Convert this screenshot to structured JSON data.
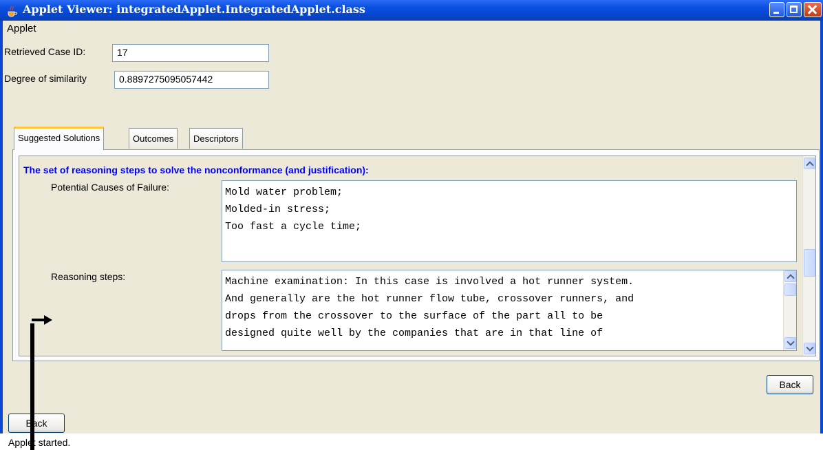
{
  "window": {
    "title": "Applet Viewer: integratedApplet.IntegratedApplet.class",
    "frame_color": "#0a47d4"
  },
  "menu": {
    "applet_label": "Applet"
  },
  "form": {
    "case_id_label": "Retrieved Case ID:",
    "case_id_value": "17",
    "similarity_label": "Degree of similarity",
    "similarity_value": "0.8897275095057442"
  },
  "tabs": [
    {
      "label": "Suggested Solutions",
      "active": true
    },
    {
      "label": "Outcomes",
      "active": false
    },
    {
      "label": "Descriptors",
      "active": false
    }
  ],
  "solutions": {
    "heading": "The set of reasoning steps to solve the nonconformance (and justification):",
    "heading_color": "#0000ff",
    "causes_label": "Potential Causes of Failure:",
    "causes_lines": [
      "Mold water problem;",
      "Molded-in stress;",
      "Too fast a cycle time;"
    ],
    "steps_label": "Reasoning steps:",
    "steps_lines": [
      "Machine examination: In this case is involved a hot runner system.",
      "And generally are the hot runner flow tube, crossover runners, and",
      "drops from the crossover to the surface of the part all to be",
      "designed quite well by the companies that are in that line of"
    ]
  },
  "buttons": {
    "panel_back": "Back",
    "bottom_back": "Back"
  },
  "status": {
    "text": "Applet started."
  },
  "icons": [
    "java-cup-icon",
    "minimize-icon",
    "maximize-icon",
    "close-icon",
    "scroll-up-icon",
    "scroll-down-icon",
    "arrow-annotation-icon"
  ]
}
